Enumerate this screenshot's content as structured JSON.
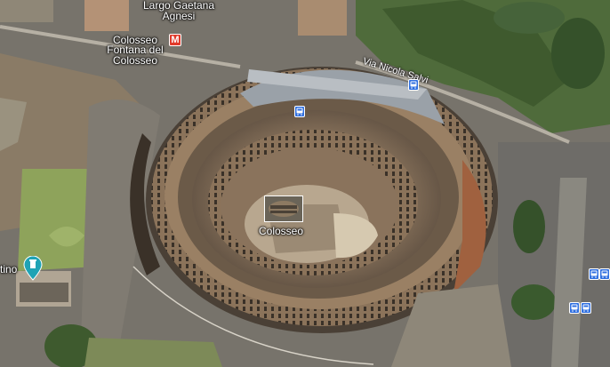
{
  "map": {
    "view": "satellite",
    "accent_bus": "#2f6fe0",
    "accent_metro": "#e03a2b"
  },
  "labels": {
    "largo": "Largo Gaetana Agnesi",
    "metro_station": "Colosseo",
    "fontana": "Fontana del Colosseo",
    "street": "Via Nicola Salvi",
    "landmark": "Colosseo",
    "left_place": "tino"
  },
  "icons": {
    "metro_symbol": "M",
    "bus": "bus-icon",
    "landmark": "photo-marker-icon",
    "tower": "tower-pin-icon"
  }
}
